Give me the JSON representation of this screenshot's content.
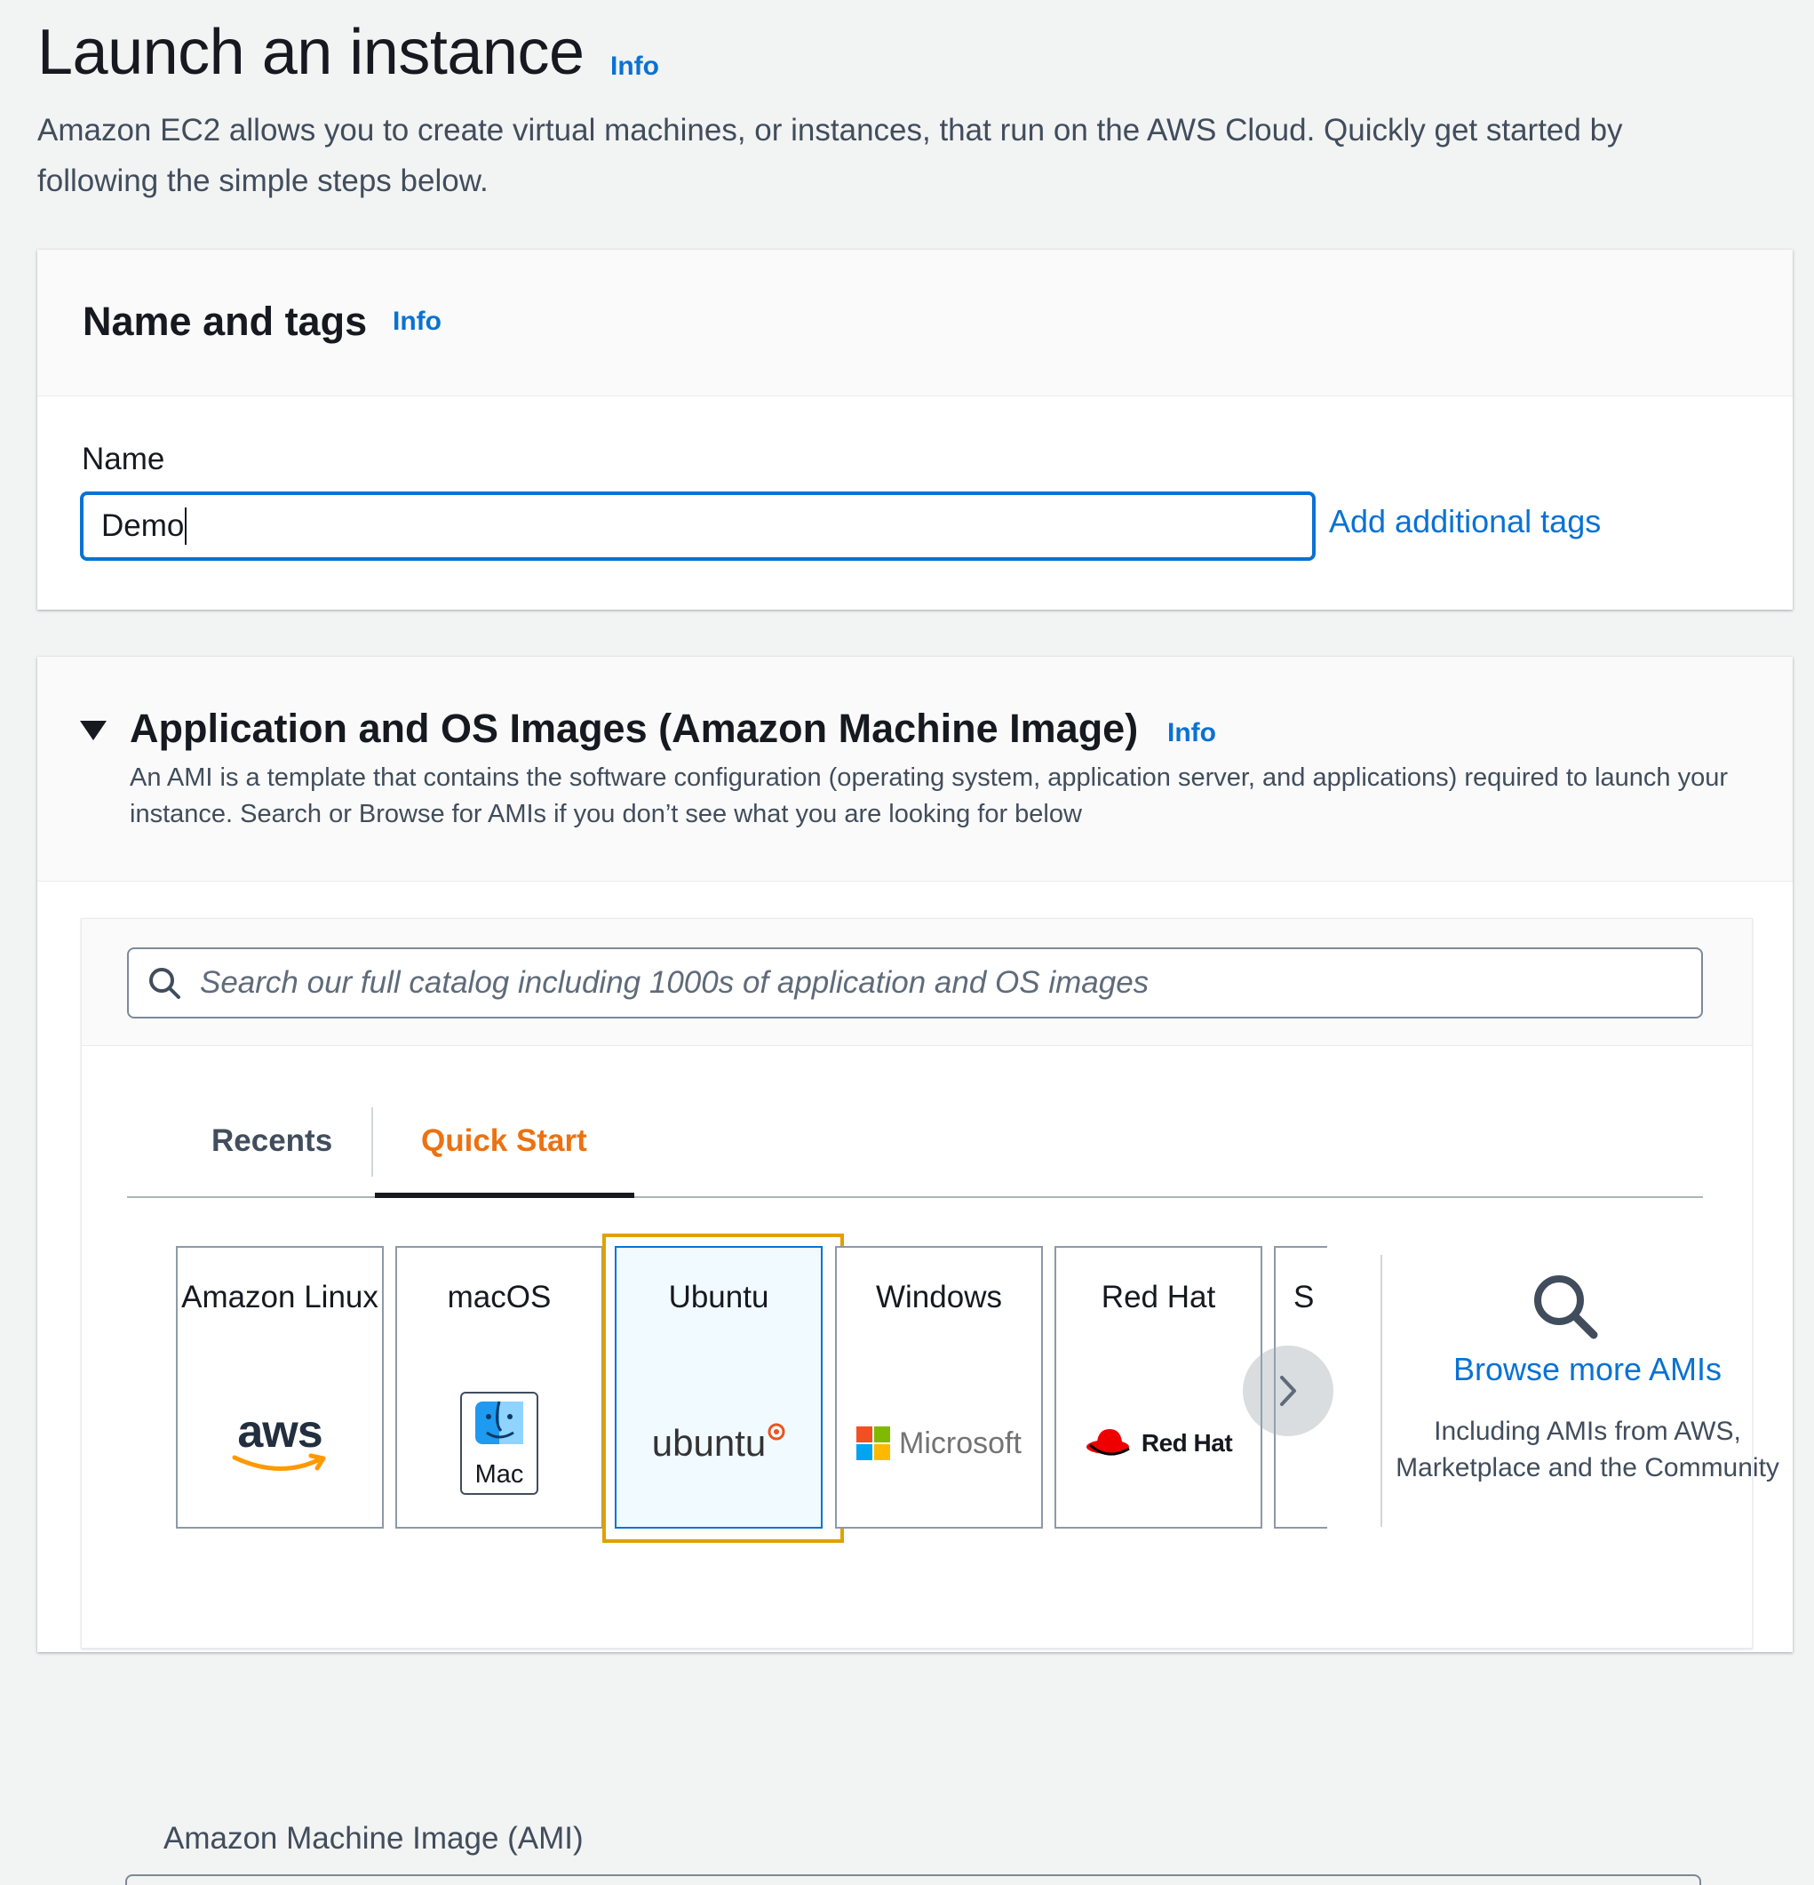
{
  "header": {
    "title": "Launch an instance",
    "info": "Info",
    "description": "Amazon EC2 allows you to create virtual machines, or instances, that run on the AWS Cloud. Quickly get started by following the simple steps below."
  },
  "name_tags": {
    "heading": "Name and tags",
    "info": "Info",
    "name_label": "Name",
    "name_value": "Demo",
    "add_tags_link": "Add additional tags"
  },
  "ami_section": {
    "heading": "Application and OS Images (Amazon Machine Image)",
    "info": "Info",
    "description": "An AMI is a template that contains the software configuration (operating system, application server, and applications) required to launch your instance. Search or Browse for AMIs if you don’t see what you are looking for below",
    "search_placeholder": "Search our full catalog including 1000s of application and OS images",
    "tabs": [
      {
        "label": "Recents",
        "active": false
      },
      {
        "label": "Quick Start",
        "active": true
      }
    ],
    "os_tiles": [
      {
        "label": "Amazon Linux",
        "logo_text": "aws",
        "icon": "aws-logo-icon"
      },
      {
        "label": "macOS",
        "logo_text": "Mac",
        "icon": "mac-finder-icon"
      },
      {
        "label": "Ubuntu",
        "logo_text": "ubuntu",
        "icon": "ubuntu-logo-icon",
        "selected": true
      },
      {
        "label": "Windows",
        "logo_text": "Microsoft",
        "icon": "microsoft-logo-icon"
      },
      {
        "label": "Red Hat",
        "logo_text": "Red Hat",
        "icon": "redhat-logo-icon"
      },
      {
        "label": "S",
        "logo_text": "",
        "icon": ""
      }
    ],
    "browse": {
      "link": "Browse more AMIs",
      "description": "Including AMIs from AWS, Marketplace and the Community"
    },
    "ami_label": "Amazon Machine Image (AMI)"
  },
  "colors": {
    "link": "#0972d3",
    "active_tab": "#ec7211",
    "highlight": "#e0a100",
    "background": "#f2f3f3"
  }
}
